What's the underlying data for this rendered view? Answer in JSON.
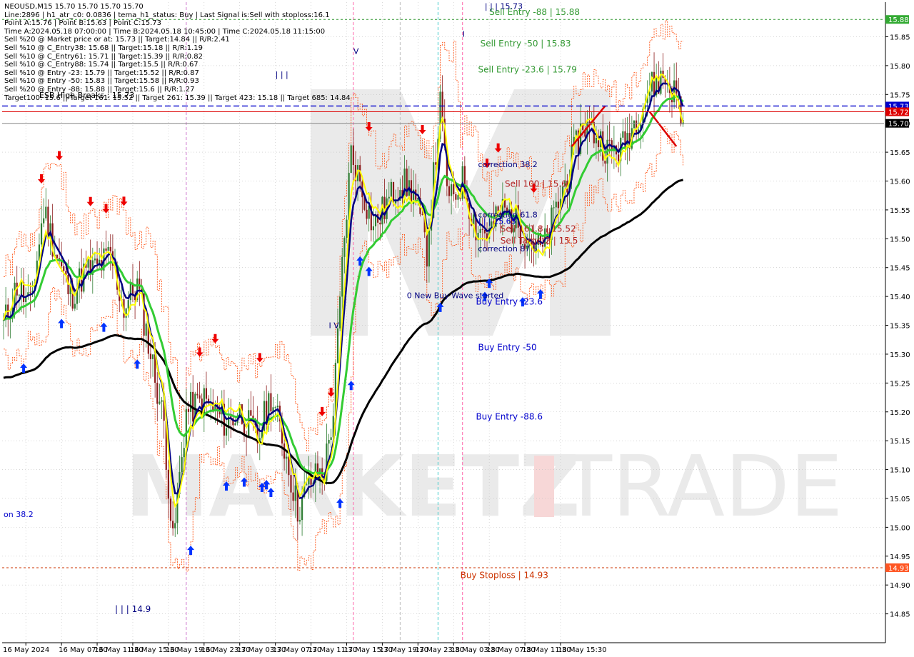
{
  "header": {
    "symbol_line": "NEOUSD,M15   15.70  15.70  15.70  15.70",
    "info_lines": [
      "Line:2896  |  h1_atr_c0: 0.0836  |  tema_h1_status: Buy  |  Last Signal is:Sell with stoploss:16.1",
      "Point A:15.76  |  Point B:15.63  |  Point C:15.73",
      "Time A:2024.05.18 07:00:00  |  Time B:2024.05.18 10:45:00  |  Time C:2024.05.18 11:15:00",
      "Sell %20 @ Market price or at: 15.73  ||  Target:14.84  ||  R/R:2.41",
      "Sell %10 @ C_Entry38: 15.68  ||  Target:15.18  ||  R/R:1.19",
      "Sell %10 @ C_Entry61: 15.71  ||  Target:15.39  ||  R/R:0.82",
      "Sell %10 @ C_Entry88: 15.74  ||  Target:15.5  ||  R/R:0.67",
      "Sell %10 @ Entry -23: 15.79  ||  Target:15.52  ||  R/R:0.87",
      "Sell %10 @ Entry -50: 15.83  ||  Target:15.58  ||  R/R:0.93",
      "Sell %20 @ Entry -88: 15.88  ||  Target:15.6  ||  R/R:1.27",
      "Target100: 15.6  ||  Target 161: 15.52  ||  Target 261: 15.39  ||  Target 423: 15.18  ||  Target 685: 14.84"
    ]
  },
  "colors": {
    "background": "#ffffff",
    "grid": "#c0c0c0",
    "axis": "#000000",
    "bull": "#2e7d32",
    "bear": "#8b1a1a",
    "ema_yellow": "#ffff00",
    "ema_navy": "#000080",
    "ema_green": "#33cc33",
    "ema_black": "#000000",
    "envelope": "#ff4500",
    "buy_arrow": "#0033ff",
    "sell_arrow": "#ee0000",
    "blue_dash": "#0000cc",
    "red_line": "#dd0000",
    "green_dash": "#339933",
    "stoploss": "#cc3300",
    "label_blue": "#0000cc",
    "label_red": "#b22222",
    "label_navy": "#000080",
    "watermark": "#d9d9d9",
    "watermark_red": "#f2b8b8"
  },
  "chart_data": {
    "type": "candlestick",
    "title": "NEOUSD,M15",
    "ylim": [
      14.8,
      15.91
    ],
    "y_ticks": [
      14.85,
      14.9,
      14.95,
      15.0,
      15.05,
      15.1,
      15.15,
      15.2,
      15.25,
      15.3,
      15.35,
      15.4,
      15.45,
      15.5,
      15.55,
      15.6,
      15.65,
      15.7,
      15.75,
      15.8,
      15.85
    ],
    "x_labels": [
      "16 May 2024",
      "16 May 07:30",
      "16 May 11:30",
      "16 May 15:30",
      "16 May 19:30",
      "16 May 23:30",
      "17 May 03:30",
      "17 May 07:30",
      "17 May 11:30",
      "17 May 15:30",
      "17 May 19:30",
      "17 May 23:30",
      "18 May 03:30",
      "18 May 07:30",
      "18 May 11:30",
      "18 May 15:30"
    ],
    "current_price": 15.7,
    "price_tags": [
      {
        "value": 15.88,
        "text": "15.88",
        "color": "#33aa33"
      },
      {
        "value": 15.73,
        "text": "15.73",
        "color": "#0000cc"
      },
      {
        "value": 15.72,
        "text": "15.72",
        "color": "#dd0000"
      },
      {
        "value": 15.7,
        "text": "15.70",
        "color": "#000000"
      },
      {
        "value": 14.93,
        "text": "14.93",
        "color": "#ff5522"
      }
    ],
    "horizontal_lines": [
      {
        "name": "green-dashed",
        "value": 15.88,
        "style": "dashed",
        "color": "#339933"
      },
      {
        "name": "blue-dashed",
        "value": 15.73,
        "style": "dashed",
        "color": "#0000cc"
      },
      {
        "name": "red-solid",
        "value": 15.72,
        "style": "solid",
        "color": "#dd0000"
      },
      {
        "name": "current-price",
        "value": 15.7,
        "style": "solid",
        "color": "#888888"
      },
      {
        "name": "buy-stoploss",
        "value": 14.93,
        "style": "dashed",
        "color": "#cc3300"
      }
    ],
    "candle_anchors": [
      [
        0,
        15.35
      ],
      [
        6,
        15.42
      ],
      [
        12,
        15.38
      ],
      [
        18,
        15.55
      ],
      [
        24,
        15.47
      ],
      [
        30,
        15.4
      ],
      [
        36,
        15.44
      ],
      [
        42,
        15.45
      ],
      [
        48,
        15.47
      ],
      [
        54,
        15.38
      ],
      [
        60,
        15.42
      ],
      [
        66,
        15.3
      ],
      [
        72,
        15.18
      ],
      [
        76,
        14.97
      ],
      [
        82,
        15.2
      ],
      [
        90,
        15.22
      ],
      [
        100,
        15.18
      ],
      [
        106,
        15.2
      ],
      [
        114,
        15.15
      ],
      [
        120,
        15.23
      ],
      [
        126,
        15.14
      ],
      [
        132,
        15.03
      ],
      [
        138,
        15.08
      ],
      [
        144,
        15.1
      ],
      [
        148,
        15.2
      ],
      [
        152,
        15.45
      ],
      [
        156,
        15.65
      ],
      [
        160,
        15.6
      ],
      [
        166,
        15.52
      ],
      [
        172,
        15.56
      ],
      [
        178,
        15.6
      ],
      [
        184,
        15.58
      ],
      [
        190,
        15.48
      ],
      [
        196,
        15.73
      ],
      [
        200,
        15.56
      ],
      [
        206,
        15.6
      ],
      [
        212,
        15.52
      ],
      [
        218,
        15.51
      ],
      [
        224,
        15.55
      ],
      [
        230,
        15.53
      ],
      [
        236,
        15.5
      ],
      [
        242,
        15.48
      ],
      [
        248,
        15.55
      ],
      [
        254,
        15.62
      ],
      [
        260,
        15.7
      ],
      [
        266,
        15.68
      ],
      [
        272,
        15.65
      ],
      [
        278,
        15.66
      ],
      [
        284,
        15.71
      ],
      [
        290,
        15.76
      ],
      [
        296,
        15.78
      ],
      [
        302,
        15.75
      ],
      [
        305,
        15.7
      ]
    ],
    "labels": [
      {
        "text": "Sell Entry -88 | 15.88",
        "value": 15.888,
        "index": 218,
        "color": "#339933"
      },
      {
        "text": "Sell Entry -50 | 15.83",
        "value": 15.833,
        "index": 214,
        "color": "#339933"
      },
      {
        "text": "Sell Entry -23.6 | 15.79",
        "value": 15.788,
        "index": 213,
        "color": "#339933"
      },
      {
        "text": "correction 38.2",
        "value": 15.624,
        "index": 213,
        "color": "#000080"
      },
      {
        "text": "Sell 100 | 15.6",
        "value": 15.59,
        "index": 225,
        "color": "#b22222"
      },
      {
        "text": "correction 61.8",
        "value": 15.537,
        "index": 213,
        "color": "#000080"
      },
      {
        "text": "| | | 15.65",
        "value": 15.526,
        "index": 213,
        "color": "#0000cc"
      },
      {
        "text": "Sell 161.8 | 15.52",
        "value": 15.512,
        "index": 223,
        "color": "#b22222"
      },
      {
        "text": "Sell Target2 | 15.5",
        "value": 15.492,
        "index": 223,
        "color": "#b22222"
      },
      {
        "text": "correction 87.5",
        "value": 15.478,
        "index": 213,
        "color": "#000080"
      },
      {
        "text": "0 New Buy Wave started",
        "value": 15.397,
        "index": 181,
        "color": "#000080"
      },
      {
        "text": "Buy Entry -23.6",
        "value": 15.386,
        "index": 212,
        "color": "#0000cc"
      },
      {
        "text": "Buy Entry -50",
        "value": 15.307,
        "index": 213,
        "color": "#0000cc"
      },
      {
        "text": "Buy Entry -88.6",
        "value": 15.187,
        "index": 212,
        "color": "#0000cc"
      },
      {
        "text": "Buy Stoploss | 14.93",
        "value": 14.912,
        "index": 205,
        "color": "#cc3300"
      },
      {
        "text": "| | | 14.9",
        "value": 14.853,
        "index": 50,
        "color": "#000080"
      },
      {
        "text": "| | |",
        "value": 15.78,
        "index": 122,
        "color": "#000080"
      },
      {
        "text": "V",
        "value": 15.82,
        "index": 157,
        "color": "#000080"
      },
      {
        "text": "I V",
        "value": 15.345,
        "index": 146,
        "color": "#000080"
      },
      {
        "text": "I",
        "value": 15.85,
        "index": 206,
        "color": "#000080"
      },
      {
        "text": "on 38.2",
        "value": 15.018,
        "index": 0,
        "color": "#0000cc"
      },
      {
        "text": "| | | 15.73",
        "value": 15.898,
        "index": 216,
        "color": "#000080"
      },
      {
        "text": "ESB High Breaks : 15.73",
        "value": 15.744,
        "index": 16,
        "color": "#000000"
      }
    ],
    "buy_arrows": [
      9,
      26,
      45,
      60,
      84,
      100,
      108,
      116,
      118,
      120,
      164,
      156,
      160,
      118,
      151,
      233,
      196,
      216,
      218,
      241
    ],
    "sell_arrows": [
      17,
      25,
      39,
      46,
      54,
      88,
      95,
      115,
      143,
      147,
      164,
      188,
      217,
      222,
      238
    ],
    "vertical_lines": [
      {
        "time": "16 May 23:30",
        "index": 82,
        "color": "#cc77cc",
        "style": "dashed"
      },
      {
        "time": "17 May 15:30",
        "index": 157,
        "color": "#ff66aa",
        "style": "dashed"
      },
      {
        "time": "17 May 19:30",
        "index": 178,
        "color": "#bbbbbb",
        "style": "dashed"
      },
      {
        "time": "18 May 03:30",
        "index": 195,
        "color": "#44cccc",
        "style": "dashed"
      },
      {
        "time": "18 May 07:30",
        "index": 206,
        "color": "#ff66aa",
        "style": "dashed"
      }
    ]
  },
  "watermark": {
    "brand_left": "MARKETZ",
    "brand_mid": "I",
    "brand_right": "TRADE"
  }
}
